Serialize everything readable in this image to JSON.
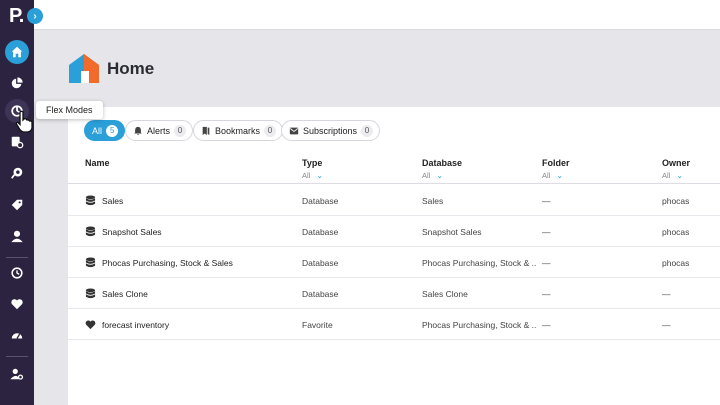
{
  "app": {
    "logo_text": "P.",
    "expand_icon": "chevron-right-icon"
  },
  "sidebar": {
    "items": [
      {
        "name": "home",
        "icon": "home-icon",
        "active": true
      },
      {
        "name": "pie",
        "icon": "pie-chart-icon"
      },
      {
        "name": "flex-modes",
        "icon": "flex-modes-icon",
        "hover": true
      },
      {
        "name": "database-settings",
        "icon": "database-gear-icon"
      },
      {
        "name": "analysis",
        "icon": "analysis-icon"
      },
      {
        "name": "tags",
        "icon": "tag-icon"
      },
      {
        "name": "user",
        "icon": "user-icon"
      },
      {
        "name": "history",
        "icon": "history-icon"
      },
      {
        "name": "favorites",
        "icon": "heart-icon"
      },
      {
        "name": "dashboard",
        "icon": "gauge-icon"
      },
      {
        "name": "admin",
        "icon": "user-settings-icon"
      }
    ]
  },
  "tooltip": {
    "text": "Flex Modes"
  },
  "page": {
    "title": "Home"
  },
  "filters": [
    {
      "label": "All",
      "count": "5",
      "active": true
    },
    {
      "label": "Alerts",
      "count": "0",
      "icon": "alert-icon"
    },
    {
      "label": "Bookmarks",
      "count": "0",
      "icon": "bookmark-icon"
    },
    {
      "label": "Subscriptions",
      "count": "0",
      "icon": "subscription-icon"
    }
  ],
  "table": {
    "columns": [
      {
        "label": "Name",
        "filter": ""
      },
      {
        "label": "Type",
        "filter": "All"
      },
      {
        "label": "Database",
        "filter": "All"
      },
      {
        "label": "Folder",
        "filter": "All"
      },
      {
        "label": "Owner",
        "filter": "All"
      }
    ],
    "rows": [
      {
        "icon": "database-icon",
        "name": "Sales",
        "type": "Database",
        "database": "Sales",
        "folder": "—",
        "owner": "phocas"
      },
      {
        "icon": "database-icon",
        "name": "Snapshot Sales",
        "type": "Database",
        "database": "Snapshot Sales",
        "folder": "—",
        "owner": "phocas"
      },
      {
        "icon": "database-icon",
        "name": "Phocas Purchasing, Stock & Sales",
        "type": "Database",
        "database": "Phocas Purchasing, Stock & ...",
        "folder": "—",
        "owner": "phocas"
      },
      {
        "icon": "database-icon",
        "name": "Sales Clone",
        "type": "Database",
        "database": "Sales Clone",
        "folder": "—",
        "owner": "—"
      },
      {
        "icon": "heart-icon",
        "name": "forecast inventory",
        "type": "Favorite",
        "database": "Phocas Purchasing, Stock & ...",
        "folder": "—",
        "owner": "—"
      }
    ]
  }
}
